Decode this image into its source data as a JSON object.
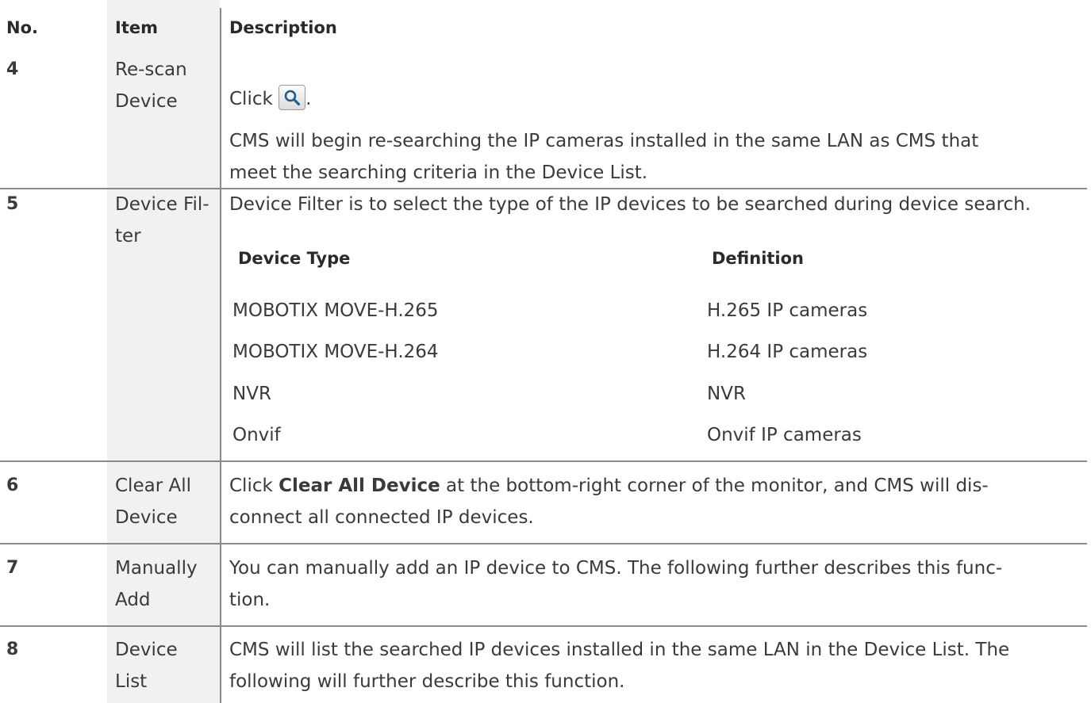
{
  "header": {
    "no": "No.",
    "item": "Item",
    "description": "Description"
  },
  "rows": [
    {
      "no": "4",
      "item_lines": [
        "Re-scan",
        "Device"
      ],
      "desc_prefix": "Click",
      "desc_suffix": ".",
      "desc_lines": [
        "CMS will begin re-searching the IP cameras installed in the same LAN as CMS that",
        "meet the searching criteria in the Device List."
      ]
    },
    {
      "no": "5",
      "item_lines": [
        "Device Fil-",
        "ter"
      ],
      "desc_lines": [
        "Device Filter is to select the type of the IP devices to be searched during device search."
      ],
      "subtable": {
        "headers": [
          "Device Type",
          "Definition"
        ],
        "rows": [
          [
            "MOBOTIX MOVE-H.265",
            "H.265 IP cameras"
          ],
          [
            "MOBOTIX MOVE-H.264",
            "H.264 IP cameras"
          ],
          [
            "NVR",
            "NVR"
          ],
          [
            "Onvif",
            "Onvif IP cameras"
          ]
        ]
      }
    },
    {
      "no": "6",
      "item_lines": [
        "Clear All",
        "Device"
      ],
      "desc_pre": "Click ",
      "desc_bold": "Clear All Device",
      "desc_post": " at the bottom-right corner of the monitor, and CMS will dis-",
      "desc_line2": "connect all connected IP devices."
    },
    {
      "no": "7",
      "item_lines": [
        "Manually",
        "Add"
      ],
      "desc_lines": [
        "You can manually add an IP device to CMS. The following further describes this func-",
        "tion."
      ]
    },
    {
      "no": "8",
      "item_lines": [
        "Device",
        "List"
      ],
      "desc_lines": [
        "CMS will list the searched IP devices installed in the same LAN in the Device List. The",
        "following will further describe this function."
      ]
    }
  ],
  "icons": {
    "rescan": "magnifier-icon"
  },
  "colors": {
    "item_column_bg": "#f1f1f1",
    "rule": "#8a8a8a",
    "text": "#3a3a3a"
  }
}
